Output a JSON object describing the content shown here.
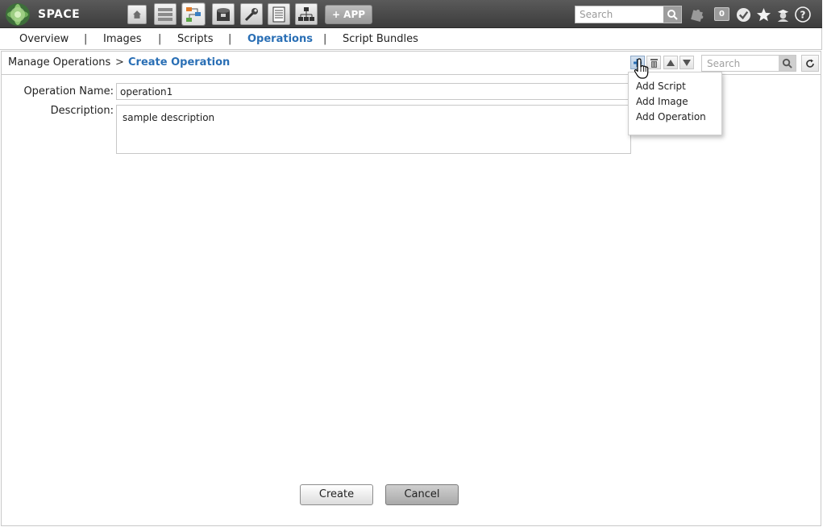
{
  "header": {
    "brand": "SPACE",
    "apps": [
      {
        "name": "home-icon"
      },
      {
        "name": "devices-icon"
      },
      {
        "name": "workflow-icon"
      },
      {
        "name": "image-archive-icon"
      },
      {
        "name": "wrench-icon"
      },
      {
        "name": "reports-icon"
      },
      {
        "name": "network-icon"
      }
    ],
    "add_app_label": "+ APP",
    "search_placeholder": "Search",
    "notification_count": "0"
  },
  "tabs": [
    {
      "label": "Overview",
      "active": false
    },
    {
      "label": "Images",
      "active": false
    },
    {
      "label": "Scripts",
      "active": false
    },
    {
      "label": "Operations",
      "active": true
    },
    {
      "label": "Script Bundles",
      "active": false
    }
  ],
  "tab_separator": "|",
  "breadcrumb": {
    "parent": "Manage Operations",
    "separator": ">",
    "current": "Create Operation"
  },
  "toolbar": {
    "search_placeholder": "Search"
  },
  "form": {
    "name_label": "Operation Name:",
    "name_value": "operation1",
    "description_label": "Description:",
    "description_value": "sample description",
    "create_label": "Create",
    "cancel_label": "Cancel"
  },
  "add_menu": {
    "items": [
      "Add Script",
      "Add Image",
      "Add Operation"
    ]
  },
  "colors": {
    "accent": "#2a6fb5",
    "topbar": "#4a4a4a"
  }
}
